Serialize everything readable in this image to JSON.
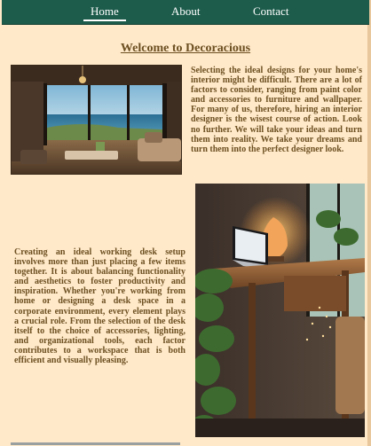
{
  "nav": {
    "items": [
      {
        "label": "Home",
        "active": true
      },
      {
        "label": "About"
      },
      {
        "label": "Contact"
      }
    ]
  },
  "page": {
    "title": "Welcome to Decoracious"
  },
  "section1": {
    "image_alt": "living room with ocean view",
    "text": "Selecting the ideal designs for your home's interior might be difficult. There are a lot of factors to consider, ranging from paint color and accessories to furniture and wallpaper. For many of us, therefore, hiring an interior designer is the wisest course of action. Look no further. We will take your ideas and turn them into reality. We take your dreams and turn them into the perfect designer look."
  },
  "section2": {
    "image_alt": "wooden desk with laptop and salt lamp",
    "text": "Creating an ideal working desk setup involves more than just placing a few items together. It is about balancing functionality and aesthetics to foster productivity and inspiration. Whether you're working from home or designing a desk space in a corporate environment, every element plays a crucial role. From the selection of the desk itself to the choice of accessories, lighting, and organizational tools, each factor contributes to a workspace that is both efficient and visually pleasing."
  },
  "colors": {
    "nav_bg": "#1d5c4b",
    "page_bg": "#ffe9c9",
    "text": "#6d5022"
  }
}
